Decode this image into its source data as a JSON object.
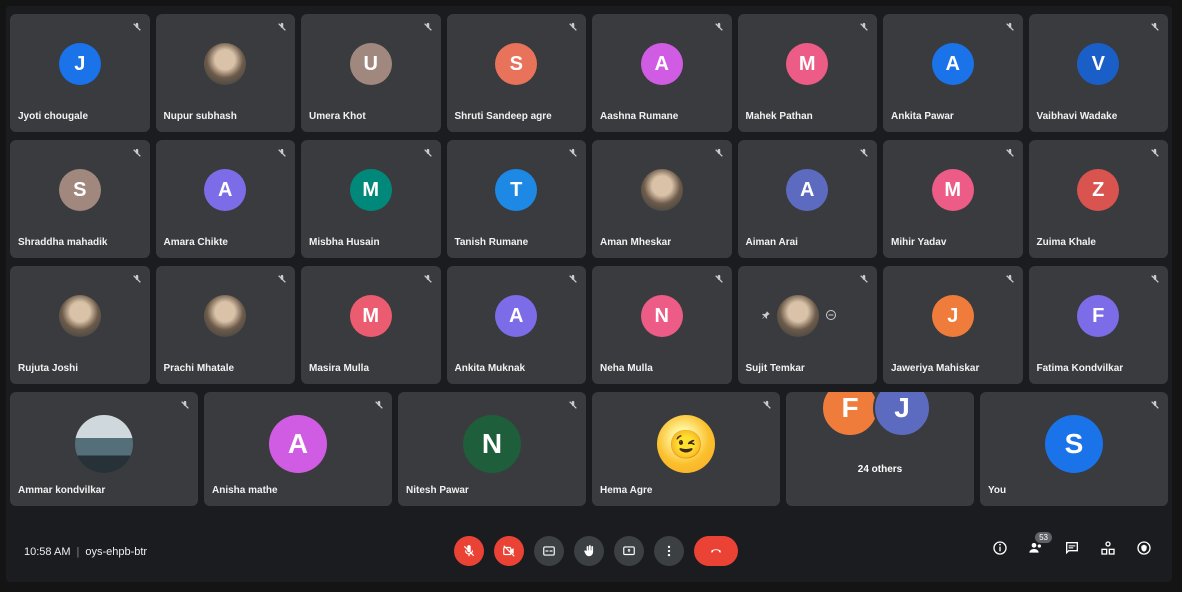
{
  "rows": [
    [
      {
        "name": "Jyoti chougale",
        "initial": "J",
        "color": "#1a73e8"
      },
      {
        "name": "Nupur subhash",
        "initial": "",
        "color": "#7a8a8f",
        "photo": true
      },
      {
        "name": "Umera Khot",
        "initial": "U",
        "color": "#a1887f"
      },
      {
        "name": "Shruti Sandeep agre",
        "initial": "S",
        "color": "#e8735a"
      },
      {
        "name": "Aashna Rumane",
        "initial": "A",
        "color": "#d05ce3"
      },
      {
        "name": "Mahek Pathan",
        "initial": "M",
        "color": "#ec5c86"
      },
      {
        "name": "Ankita Pawar",
        "initial": "A",
        "color": "#1a73e8"
      },
      {
        "name": "Vaibhavi Wadake",
        "initial": "V",
        "color": "#1a5fc8"
      }
    ],
    [
      {
        "name": "Shraddha mahadik",
        "initial": "S",
        "color": "#a1887f"
      },
      {
        "name": "Amara Chikte",
        "initial": "A",
        "color": "#7c6ce8"
      },
      {
        "name": "Misbha Husain",
        "initial": "M",
        "color": "#00897b"
      },
      {
        "name": "Tanish Rumane",
        "initial": "T",
        "color": "#1e88e5"
      },
      {
        "name": "Aman Mheskar",
        "initial": "",
        "color": "#cccccc",
        "photo": true
      },
      {
        "name": "Aiman Arai",
        "initial": "A",
        "color": "#5c6bc0"
      },
      {
        "name": "Mihir Yadav",
        "initial": "M",
        "color": "#ec5c86"
      },
      {
        "name": "Zuima Khale",
        "initial": "Z",
        "color": "#d9534f"
      }
    ],
    [
      {
        "name": "Rujuta Joshi",
        "initial": "",
        "color": "#8d6e63",
        "photo": true
      },
      {
        "name": "Prachi Mhatale",
        "initial": "",
        "color": "#bcaaa4",
        "photo": true
      },
      {
        "name": "Masira Mulla",
        "initial": "M",
        "color": "#ec5c70"
      },
      {
        "name": "Ankita Muknak",
        "initial": "A",
        "color": "#7c6ce8"
      },
      {
        "name": "Neha Mulla",
        "initial": "N",
        "color": "#ec5c86"
      },
      {
        "name": "Sujit Temkar",
        "initial": "",
        "color": "#888888",
        "photo": true,
        "pinned": true
      },
      {
        "name": "Jaweriya Mahiskar",
        "initial": "J",
        "color": "#f07c3c"
      },
      {
        "name": "Fatima Kondvilkar",
        "initial": "F",
        "color": "#7c6ce8"
      }
    ]
  ],
  "row4": [
    {
      "name": "Ammar kondvilkar",
      "initial": "",
      "color": "#90a4ae",
      "photo": true,
      "landscape": true
    },
    {
      "name": "Anisha mathe",
      "initial": "A",
      "color": "#d05ce3"
    },
    {
      "name": "Nitesh Pawar",
      "initial": "N",
      "color": "#1e5e3a"
    },
    {
      "name": "Hema Agre",
      "initial": "😉",
      "color": "#fbc02d",
      "emoji": true
    }
  ],
  "others": {
    "label": "24 others",
    "initials": [
      "F",
      "J"
    ],
    "colors": [
      "#f07c3c",
      "#5c6bc0"
    ]
  },
  "self": {
    "name": "You",
    "initial": "S",
    "color": "#1a73e8"
  },
  "bar": {
    "time": "10:58 AM",
    "separator": "|",
    "meeting_code": "oys-ehpb-btr",
    "participants_count": "53"
  },
  "icons": {
    "mic_muted": "🎙",
    "controls": [
      "mic-off",
      "camera-off",
      "captions",
      "raise-hand",
      "present",
      "more",
      "end-call"
    ],
    "right": [
      "info",
      "people",
      "chat",
      "activities",
      "host-controls"
    ]
  }
}
